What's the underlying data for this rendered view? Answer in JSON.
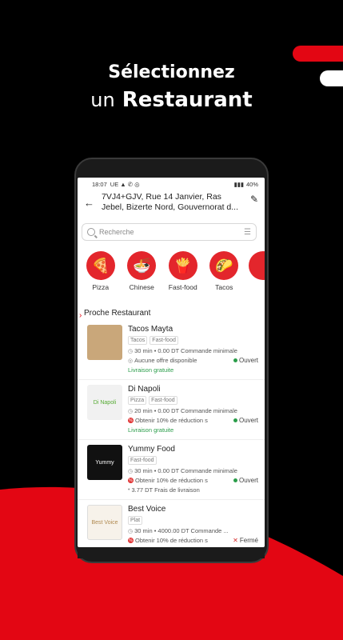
{
  "headline": {
    "line1": "Sélectionnez",
    "line2_light": "un",
    "line2_bold": "Restaurant"
  },
  "status_bar": {
    "time": "18:07",
    "left_icons": "UE ▲ ✆ ◎",
    "battery": "40%"
  },
  "address": {
    "text": "7VJ4+GJV, Rue 14 Janvier, Ras Jebel, Bizerte Nord, Gouvernorat d..."
  },
  "search": {
    "placeholder": "Recherche"
  },
  "categories": [
    {
      "label": "Pizza",
      "icon": "pizza-icon",
      "glyph": "🍕"
    },
    {
      "label": "Chinese",
      "icon": "noodles-icon",
      "glyph": "🍜"
    },
    {
      "label": "Fast-food",
      "icon": "fast-food-icon",
      "glyph": "🍟"
    },
    {
      "label": "Tacos",
      "icon": "taco-icon",
      "glyph": "🌮"
    }
  ],
  "section_title": "Proche Restaurant",
  "restaurants": [
    {
      "name": "Tacos Mayta",
      "tags": [
        "Tacos",
        "Fast-food"
      ],
      "time": "30 min",
      "min_order": "0.00 DT Commande minimale",
      "offer": "Aucune offre disponible",
      "status": "Ouvert",
      "extra": "Livraison gratuite",
      "thumb_color": "#c9a77a"
    },
    {
      "name": "Di Napoli",
      "tags": [
        "Pizza",
        "Fast-food"
      ],
      "time": "20 min",
      "min_order": "0.00 DT Commande minimale",
      "offer": "Obtenir 10%  de réduction s",
      "status": "Ouvert",
      "extra": "Livraison gratuite",
      "thumb_color": "#f1f1f1",
      "thumb_text": "Di Napoli"
    },
    {
      "name": "Yummy Food",
      "tags": [
        "Fast-food"
      ],
      "time": "30 min",
      "min_order": "0.00 DT Commande minimale",
      "offer": "Obtenir 10%  de réduction s",
      "status": "Ouvert",
      "extra": "3.77 DT Frais de livraison",
      "thumb_color": "#111111",
      "thumb_text": "Yummy"
    },
    {
      "name": "Best Voice",
      "tags": [
        "Plat"
      ],
      "time": "30 min",
      "min_order": "4000.00 DT Commande ...",
      "offer": "Obtenir 10%  de réduction s",
      "status": "Fermé",
      "extra": "",
      "thumb_color": "#f7f2ea",
      "thumb_text": "Best Voice"
    }
  ],
  "colors": {
    "brand_red": "#e30613",
    "open_green": "#2a9d4a",
    "closed_red": "#d52b2b"
  }
}
